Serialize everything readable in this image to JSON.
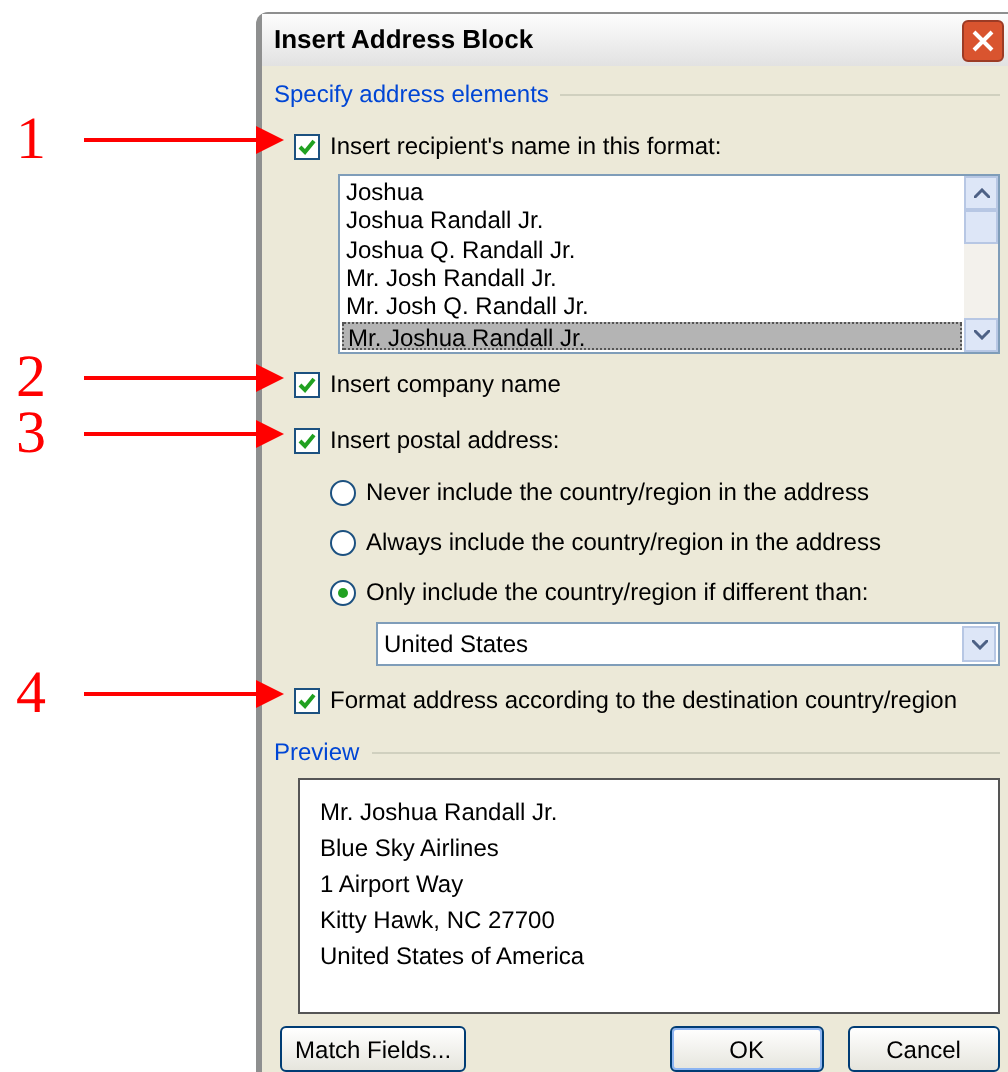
{
  "window": {
    "title": "Insert Address Block"
  },
  "section": {
    "title": "Specify address elements"
  },
  "name_format": {
    "callout": "1",
    "label": "Insert recipient's name in this format:",
    "checked": true,
    "formats": [
      {
        "text": "Joshua",
        "selected": false
      },
      {
        "text": "Joshua Randall Jr.",
        "selected": false
      },
      {
        "text": "Joshua Q. Randall Jr.",
        "selected": false
      },
      {
        "text": "Mr. Josh Randall Jr.",
        "selected": false
      },
      {
        "text": "Mr. Josh Q. Randall Jr.",
        "selected": false
      },
      {
        "text": "Mr. Joshua Randall Jr.",
        "selected": true
      }
    ]
  },
  "company": {
    "callout": "2",
    "label": "Insert company name",
    "checked": true
  },
  "postal": {
    "callout": "3",
    "label": "Insert postal address:",
    "checked": true,
    "options": [
      {
        "label": "Never include the country/region in the address",
        "selected": false
      },
      {
        "label": "Always include the country/region in the address",
        "selected": false
      },
      {
        "label": "Only include the country/region if different than:",
        "selected": true
      }
    ],
    "country": "United States"
  },
  "format": {
    "callout": "4",
    "label": "Format address according to the destination country/region",
    "checked": true
  },
  "preview": {
    "title": "Preview",
    "lines": [
      "Mr. Joshua Randall Jr.",
      "Blue Sky Airlines",
      "1 Airport Way",
      "Kitty Hawk, NC 27700",
      "United States of America"
    ]
  },
  "buttons": [
    {
      "label": "Match Fields...",
      "kind": "secondary"
    },
    {
      "label": "OK",
      "kind": "default"
    },
    {
      "label": "Cancel",
      "kind": "normal"
    }
  ]
}
